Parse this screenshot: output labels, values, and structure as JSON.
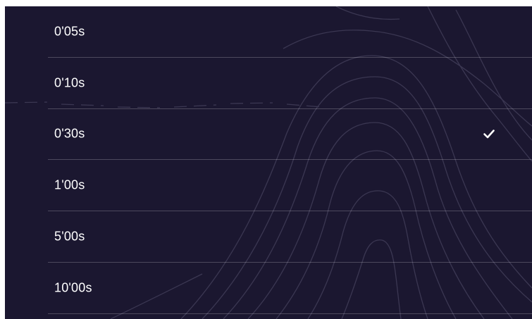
{
  "menu": {
    "items": [
      {
        "label": "0'05s",
        "selected": false
      },
      {
        "label": "0'10s",
        "selected": false
      },
      {
        "label": "0'30s",
        "selected": true
      },
      {
        "label": "1'00s",
        "selected": false
      },
      {
        "label": "5'00s",
        "selected": false
      },
      {
        "label": "10'00s",
        "selected": false
      }
    ],
    "selected_icon": "checkmark-icon"
  },
  "colors": {
    "background": "#1b1730",
    "text": "#ffffff",
    "divider": "#4a4660",
    "contour": "#3a3650"
  }
}
